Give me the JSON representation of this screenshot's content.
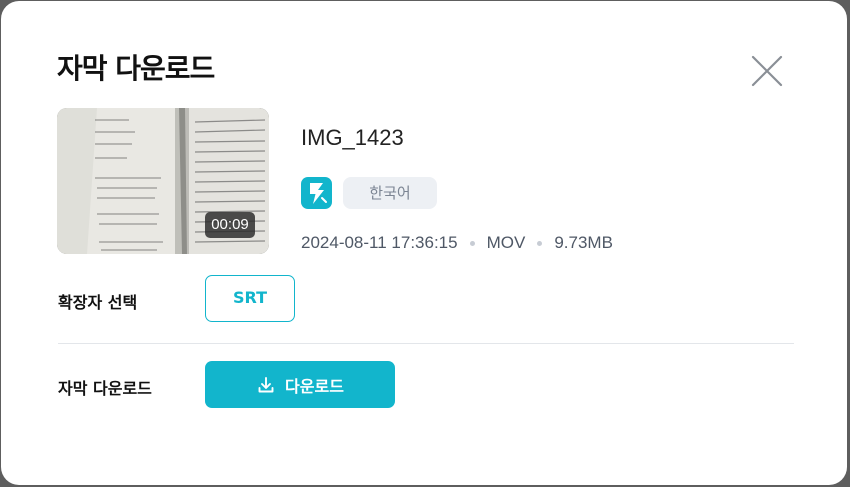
{
  "modal": {
    "title": "자막 다운로드"
  },
  "video": {
    "file_name": "IMG_1423",
    "duration": "00:09",
    "language": "한국어",
    "date": "2024-08-11 17:36:15",
    "format": "MOV",
    "size": "9.73MB"
  },
  "extension": {
    "label": "확장자 선택",
    "option": "SRT"
  },
  "download": {
    "label": "자막 다운로드",
    "button_label": "다운로드"
  },
  "colors": {
    "accent": "#12b5cc",
    "chip_bg": "#edf0f4"
  },
  "icons": {
    "close": "close-icon",
    "app": "lightning-icon",
    "download": "download-icon"
  }
}
